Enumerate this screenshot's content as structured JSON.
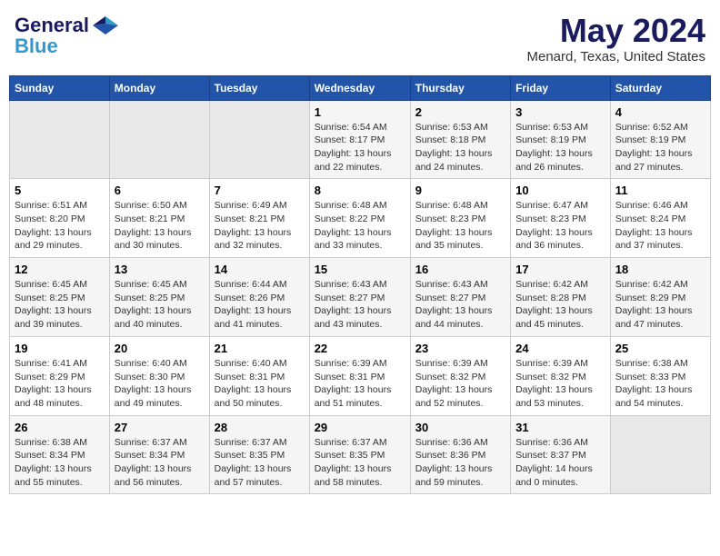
{
  "app": {
    "name": "GeneralBlue",
    "title": "May 2024",
    "subtitle": "Menard, Texas, United States"
  },
  "calendar": {
    "headers": [
      "Sunday",
      "Monday",
      "Tuesday",
      "Wednesday",
      "Thursday",
      "Friday",
      "Saturday"
    ],
    "weeks": [
      {
        "days": [
          {
            "num": "",
            "info": "",
            "empty": true
          },
          {
            "num": "",
            "info": "",
            "empty": true
          },
          {
            "num": "",
            "info": "",
            "empty": true
          },
          {
            "num": "1",
            "info": "Sunrise: 6:54 AM\nSunset: 8:17 PM\nDaylight: 13 hours\nand 22 minutes.",
            "empty": false
          },
          {
            "num": "2",
            "info": "Sunrise: 6:53 AM\nSunset: 8:18 PM\nDaylight: 13 hours\nand 24 minutes.",
            "empty": false
          },
          {
            "num": "3",
            "info": "Sunrise: 6:53 AM\nSunset: 8:19 PM\nDaylight: 13 hours\nand 26 minutes.",
            "empty": false
          },
          {
            "num": "4",
            "info": "Sunrise: 6:52 AM\nSunset: 8:19 PM\nDaylight: 13 hours\nand 27 minutes.",
            "empty": false
          }
        ]
      },
      {
        "days": [
          {
            "num": "5",
            "info": "Sunrise: 6:51 AM\nSunset: 8:20 PM\nDaylight: 13 hours\nand 29 minutes.",
            "empty": false
          },
          {
            "num": "6",
            "info": "Sunrise: 6:50 AM\nSunset: 8:21 PM\nDaylight: 13 hours\nand 30 minutes.",
            "empty": false
          },
          {
            "num": "7",
            "info": "Sunrise: 6:49 AM\nSunset: 8:21 PM\nDaylight: 13 hours\nand 32 minutes.",
            "empty": false
          },
          {
            "num": "8",
            "info": "Sunrise: 6:48 AM\nSunset: 8:22 PM\nDaylight: 13 hours\nand 33 minutes.",
            "empty": false
          },
          {
            "num": "9",
            "info": "Sunrise: 6:48 AM\nSunset: 8:23 PM\nDaylight: 13 hours\nand 35 minutes.",
            "empty": false
          },
          {
            "num": "10",
            "info": "Sunrise: 6:47 AM\nSunset: 8:23 PM\nDaylight: 13 hours\nand 36 minutes.",
            "empty": false
          },
          {
            "num": "11",
            "info": "Sunrise: 6:46 AM\nSunset: 8:24 PM\nDaylight: 13 hours\nand 37 minutes.",
            "empty": false
          }
        ]
      },
      {
        "days": [
          {
            "num": "12",
            "info": "Sunrise: 6:45 AM\nSunset: 8:25 PM\nDaylight: 13 hours\nand 39 minutes.",
            "empty": false
          },
          {
            "num": "13",
            "info": "Sunrise: 6:45 AM\nSunset: 8:25 PM\nDaylight: 13 hours\nand 40 minutes.",
            "empty": false
          },
          {
            "num": "14",
            "info": "Sunrise: 6:44 AM\nSunset: 8:26 PM\nDaylight: 13 hours\nand 41 minutes.",
            "empty": false
          },
          {
            "num": "15",
            "info": "Sunrise: 6:43 AM\nSunset: 8:27 PM\nDaylight: 13 hours\nand 43 minutes.",
            "empty": false
          },
          {
            "num": "16",
            "info": "Sunrise: 6:43 AM\nSunset: 8:27 PM\nDaylight: 13 hours\nand 44 minutes.",
            "empty": false
          },
          {
            "num": "17",
            "info": "Sunrise: 6:42 AM\nSunset: 8:28 PM\nDaylight: 13 hours\nand 45 minutes.",
            "empty": false
          },
          {
            "num": "18",
            "info": "Sunrise: 6:42 AM\nSunset: 8:29 PM\nDaylight: 13 hours\nand 47 minutes.",
            "empty": false
          }
        ]
      },
      {
        "days": [
          {
            "num": "19",
            "info": "Sunrise: 6:41 AM\nSunset: 8:29 PM\nDaylight: 13 hours\nand 48 minutes.",
            "empty": false
          },
          {
            "num": "20",
            "info": "Sunrise: 6:40 AM\nSunset: 8:30 PM\nDaylight: 13 hours\nand 49 minutes.",
            "empty": false
          },
          {
            "num": "21",
            "info": "Sunrise: 6:40 AM\nSunset: 8:31 PM\nDaylight: 13 hours\nand 50 minutes.",
            "empty": false
          },
          {
            "num": "22",
            "info": "Sunrise: 6:39 AM\nSunset: 8:31 PM\nDaylight: 13 hours\nand 51 minutes.",
            "empty": false
          },
          {
            "num": "23",
            "info": "Sunrise: 6:39 AM\nSunset: 8:32 PM\nDaylight: 13 hours\nand 52 minutes.",
            "empty": false
          },
          {
            "num": "24",
            "info": "Sunrise: 6:39 AM\nSunset: 8:32 PM\nDaylight: 13 hours\nand 53 minutes.",
            "empty": false
          },
          {
            "num": "25",
            "info": "Sunrise: 6:38 AM\nSunset: 8:33 PM\nDaylight: 13 hours\nand 54 minutes.",
            "empty": false
          }
        ]
      },
      {
        "days": [
          {
            "num": "26",
            "info": "Sunrise: 6:38 AM\nSunset: 8:34 PM\nDaylight: 13 hours\nand 55 minutes.",
            "empty": false
          },
          {
            "num": "27",
            "info": "Sunrise: 6:37 AM\nSunset: 8:34 PM\nDaylight: 13 hours\nand 56 minutes.",
            "empty": false
          },
          {
            "num": "28",
            "info": "Sunrise: 6:37 AM\nSunset: 8:35 PM\nDaylight: 13 hours\nand 57 minutes.",
            "empty": false
          },
          {
            "num": "29",
            "info": "Sunrise: 6:37 AM\nSunset: 8:35 PM\nDaylight: 13 hours\nand 58 minutes.",
            "empty": false
          },
          {
            "num": "30",
            "info": "Sunrise: 6:36 AM\nSunset: 8:36 PM\nDaylight: 13 hours\nand 59 minutes.",
            "empty": false
          },
          {
            "num": "31",
            "info": "Sunrise: 6:36 AM\nSunset: 8:37 PM\nDaylight: 14 hours\nand 0 minutes.",
            "empty": false
          },
          {
            "num": "",
            "info": "",
            "empty": true
          }
        ]
      }
    ]
  }
}
